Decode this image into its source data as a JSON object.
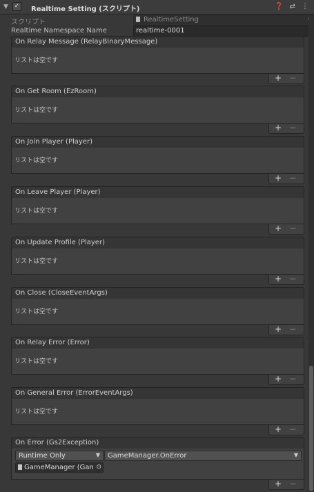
{
  "header": {
    "collapse_icon": "triangle-down",
    "enabled_icon": "checkbox-checked",
    "title": "Realtime Setting (スクリプト)",
    "help_icon": "question-circle",
    "preset_icon": "sliders",
    "menu_icon": "kebab-vertical"
  },
  "script_field": {
    "label": "スクリプト",
    "value": "RealtimeSetting"
  },
  "namespace_field": {
    "label": "Realtime Namespace Name",
    "value": "realtime-0001"
  },
  "events": [
    {
      "title": "On Relay Message (RelayBinaryMessage)",
      "empty_text": "リストは空です"
    },
    {
      "title": "On Get Room (EzRoom)",
      "empty_text": "リストは空です"
    },
    {
      "title": "On Join Player (Player)",
      "empty_text": "リストは空です"
    },
    {
      "title": "On Leave Player (Player)",
      "empty_text": "リストは空です"
    },
    {
      "title": "On Update Profile (Player)",
      "empty_text": "リストは空です"
    },
    {
      "title": "On Close (CloseEventArgs)",
      "empty_text": "リストは空です"
    },
    {
      "title": "On Relay Error (Error)",
      "empty_text": "リストは空です"
    },
    {
      "title": "On General Error (ErrorEventArgs)",
      "empty_text": "リストは空です"
    }
  ],
  "error_event": {
    "title": "On Error (Gs2Exception)",
    "mode": "Runtime Only",
    "function": "GameManager.OnError",
    "target": "GameManager (Game"
  },
  "footer": {
    "add_label": "+",
    "remove_label": "−"
  }
}
